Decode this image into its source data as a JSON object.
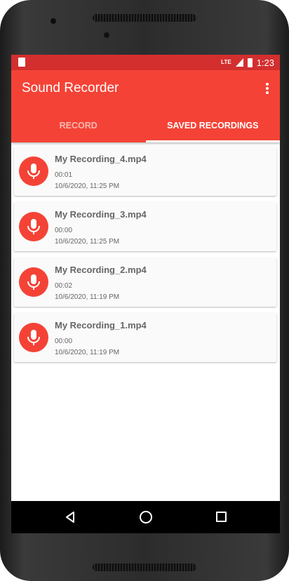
{
  "status_bar": {
    "network": "LTE",
    "time": "1:23"
  },
  "app_bar": {
    "title": "Sound Recorder",
    "overflow_icon": "more-vert-icon"
  },
  "tabs": [
    {
      "label": "RECORD",
      "selected": false
    },
    {
      "label": "SAVED RECORDINGS",
      "selected": true
    }
  ],
  "recordings": [
    {
      "name": "My Recording_4.mp4",
      "duration": "00:01",
      "date": "10/6/2020, 11:25 PM"
    },
    {
      "name": "My Recording_3.mp4",
      "duration": "00:00",
      "date": "10/6/2020, 11:25 PM"
    },
    {
      "name": "My Recording_2.mp4",
      "duration": "00:02",
      "date": "10/6/2020, 11:19 PM"
    },
    {
      "name": "My Recording_1.mp4",
      "duration": "00:00",
      "date": "10/6/2020, 11:19 PM"
    }
  ],
  "colors": {
    "status_bar": "#d32f2f",
    "primary": "#f44336",
    "text_secondary": "#666666"
  },
  "nav_icons": [
    "back-icon",
    "home-icon",
    "recents-icon"
  ]
}
